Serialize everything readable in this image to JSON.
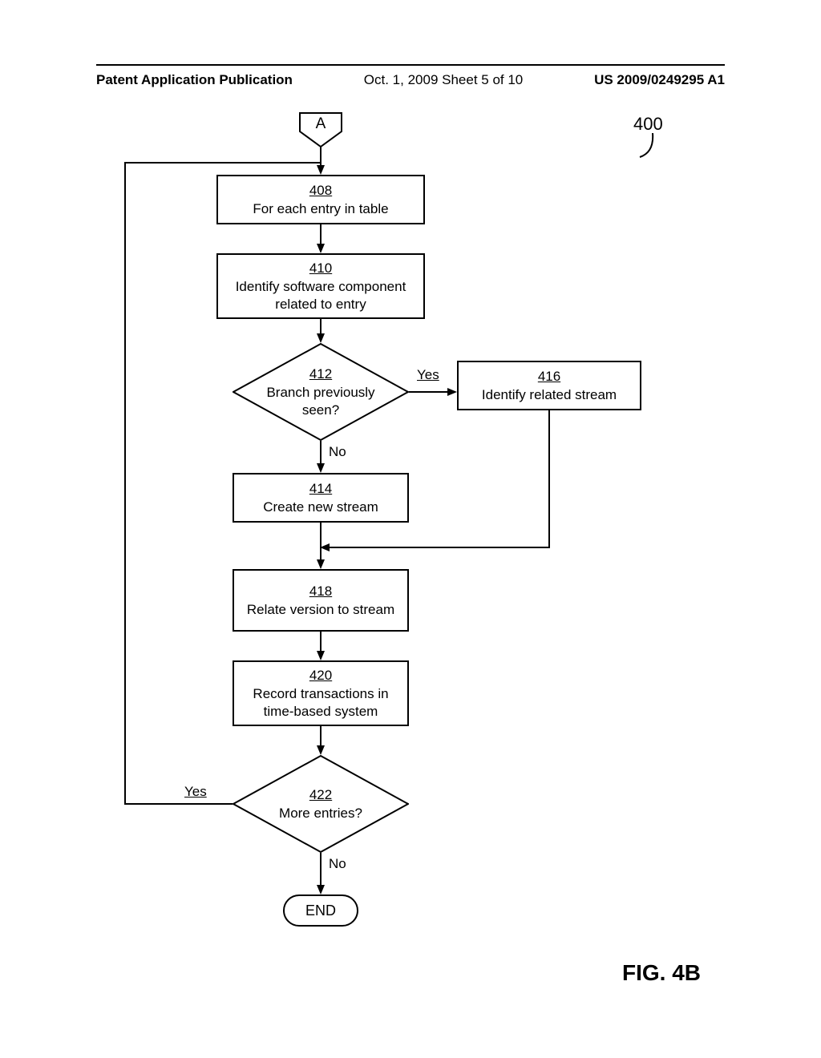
{
  "header": {
    "left": "Patent Application Publication",
    "mid": "Oct. 1, 2009  Sheet 5 of 10",
    "right": "US 2009/0249295 A1"
  },
  "refnum": "400",
  "figure_label": "FIG. 4B",
  "connector_a": "A",
  "terminator_end": "END",
  "boxes": {
    "b408": {
      "num": "408",
      "text": "For each entry in table"
    },
    "b410": {
      "num": "410",
      "text": "Identify software component related to entry"
    },
    "b414": {
      "num": "414",
      "text": "Create new stream"
    },
    "b416": {
      "num": "416",
      "text": "Identify related stream"
    },
    "b418": {
      "num": "418",
      "text": "Relate version to stream"
    },
    "b420": {
      "num": "420",
      "text": "Record transactions in time-based system"
    }
  },
  "decisions": {
    "d412": {
      "num": "412",
      "text": "Branch previously seen?"
    },
    "d422": {
      "num": "422",
      "text": "More entries?"
    }
  },
  "labels": {
    "yes": "Yes",
    "no": "No"
  }
}
